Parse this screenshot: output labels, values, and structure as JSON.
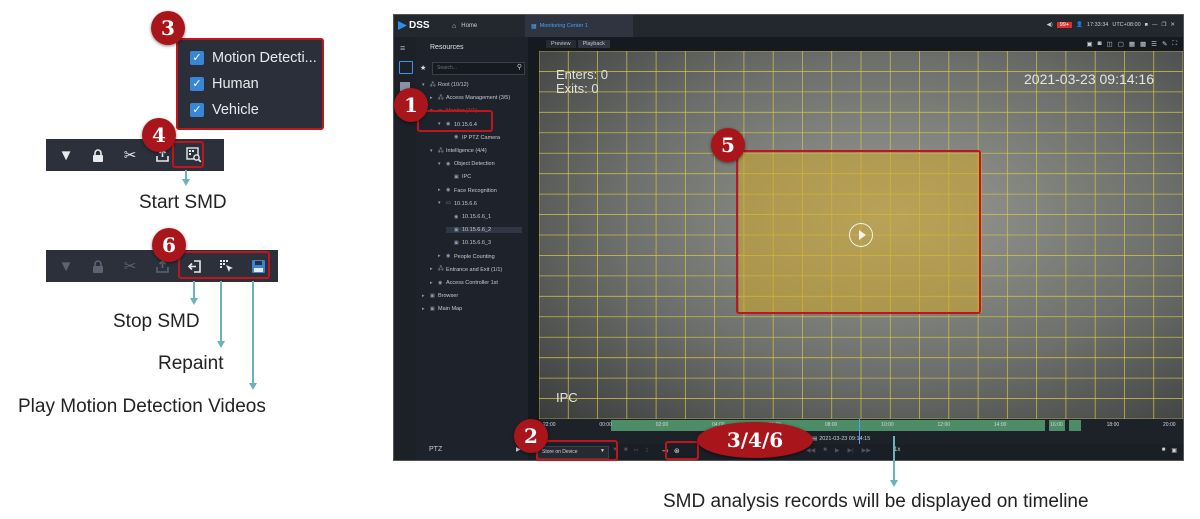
{
  "callouts": {
    "c1": "1",
    "c2": "2",
    "c3": "3",
    "c4": "4",
    "c5": "5",
    "c6": "6",
    "c346": "3/4/6"
  },
  "checkbox_panel": {
    "items": [
      {
        "label": "Motion Detecti...",
        "checked": true
      },
      {
        "label": "Human",
        "checked": true
      },
      {
        "label": "Vehicle",
        "checked": true
      }
    ]
  },
  "toolbar_top": {
    "icons": [
      "filter-icon",
      "lock-icon",
      "scissors-icon",
      "export-icon",
      "smd-search-icon"
    ]
  },
  "toolbar_bottom": {
    "icons": [
      "filter-icon",
      "lock-icon",
      "scissors-icon",
      "export-icon",
      "stop-smd-icon",
      "repaint-icon",
      "play-md-videos-icon"
    ]
  },
  "captions": {
    "start_smd": "Start SMD",
    "stop_smd": "Stop SMD",
    "repaint": "Repaint",
    "play_md": "Play Motion Detection Videos",
    "timeline_note": "SMD analysis records will be displayed on timeline"
  },
  "app": {
    "logo": "DSS",
    "home_tab": "Home",
    "active_tab": "Monitoring Center 1",
    "clock": "17:33:34",
    "timezone": "UTC+08:00",
    "alarm_badge": "99+",
    "resources_title": "Resources",
    "search_placeholder": "Search...",
    "view_tabs": [
      "Preview",
      "Playback"
    ],
    "tree": [
      {
        "label": "Root (10/12)"
      },
      {
        "label": "Access Management (3/5)"
      },
      {
        "label": "Monitor (1/1)"
      },
      {
        "label": "10.15.6.4"
      },
      {
        "label": "IP PTZ Camera"
      },
      {
        "label": "Intelligence (4/4)"
      },
      {
        "label": "Object Detection"
      },
      {
        "label": "IPC"
      },
      {
        "label": "Face Recognition"
      },
      {
        "label": "10.15.6.6"
      },
      {
        "label": "10.15.6.6_1"
      },
      {
        "label": "10.15.6.6_2"
      },
      {
        "label": "10.15.6.6_3"
      },
      {
        "label": "People Counting"
      },
      {
        "label": "Entrance and Exit (1/1)"
      },
      {
        "label": "Access Controller 1st"
      },
      {
        "label": "Browser"
      },
      {
        "label": "Main Map"
      }
    ],
    "video": {
      "enters": "Enters: 0",
      "exits": "Exits: 0",
      "timestamp": "2021-03-23 09:14:16",
      "channel": "IPC"
    },
    "timeline_ticks": [
      "22:00",
      "00:00",
      "02:00",
      "04:00",
      "06:00",
      "08:00",
      "10:00",
      "12:00",
      "14:00",
      "16:00",
      "18:00",
      "20:00"
    ],
    "timeline_cursor": "2021-03-23 09:14:15",
    "ptz_label": "PTZ",
    "store_select": "Store on Device",
    "speed": "1x"
  },
  "colors": {
    "callout_red": "#a8161b",
    "box_red": "#c0151b",
    "accent_blue": "#3a86d6",
    "grid_yellow": "#d8c640",
    "arrow_teal": "#6bb3bb"
  }
}
